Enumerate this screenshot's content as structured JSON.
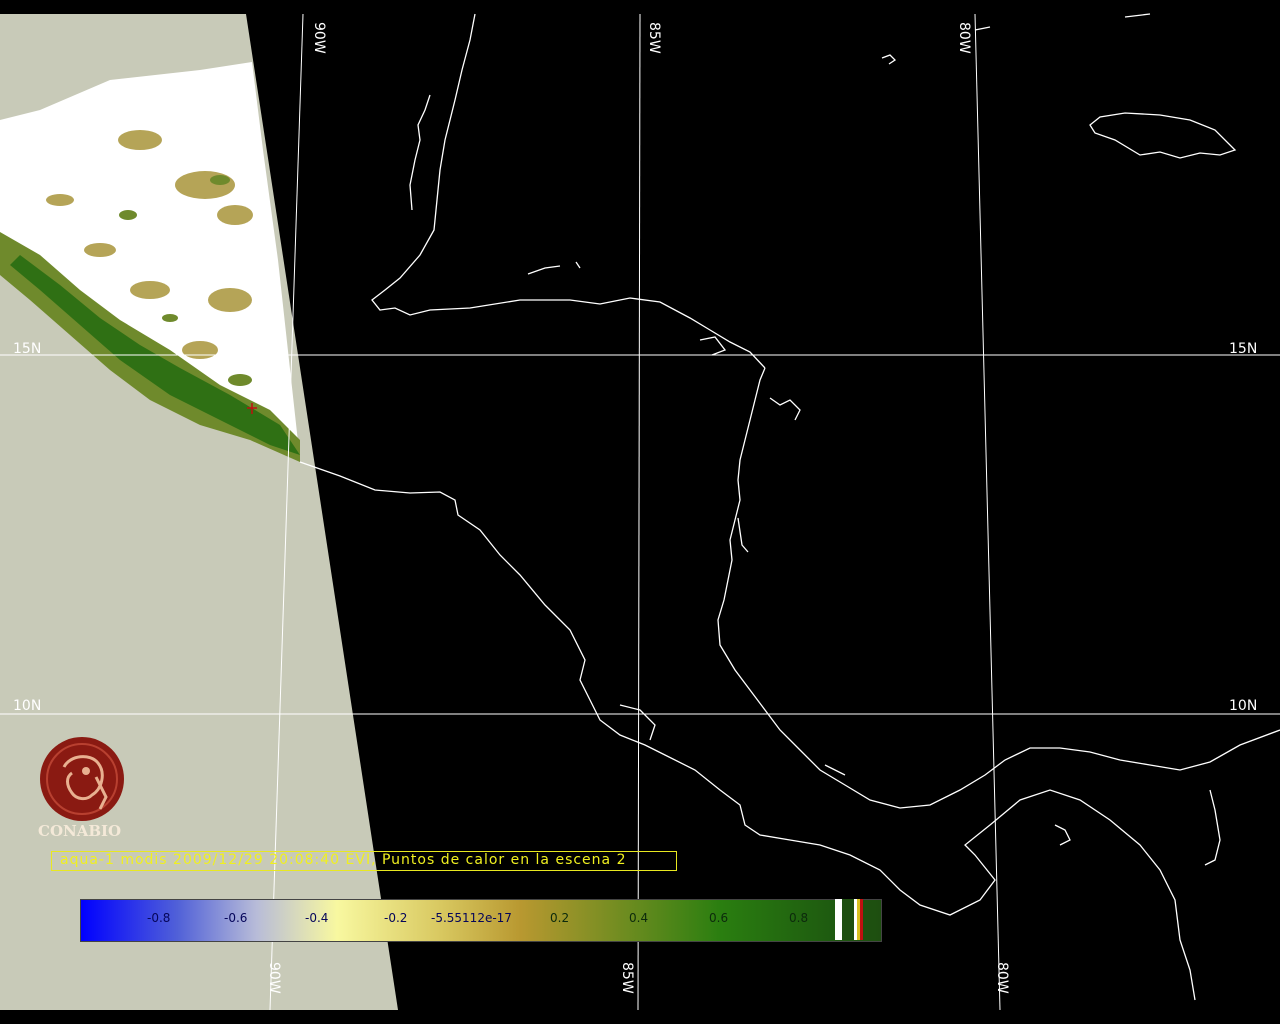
{
  "map": {
    "gridlines": {
      "meridians": [
        "90W",
        "85W",
        "80W"
      ],
      "parallels": [
        "15N",
        "10N"
      ]
    },
    "colors": {
      "background": "#000000",
      "out_of_swath": "#c8cab8",
      "cloud": "#ffffff",
      "coastline": "#ffffff",
      "gridline": "#ffffff",
      "caption": "#f0f020"
    }
  },
  "caption": {
    "text": "aqua-1 modis 2009/12/29 20:08:40 EVI, Puntos de calor en la escena 2"
  },
  "logo": {
    "name": "CONABIO",
    "icon": "conabio-macaw-logo"
  },
  "legend": {
    "ticks": [
      "-0.8",
      "-0.6",
      "-0.4",
      "-0.2",
      "-5.55112e-17",
      "0.2",
      "0.4",
      "0.6",
      "0.8"
    ],
    "colors": [
      "#0000ff",
      "#b8bcd8",
      "#f8f8a0",
      "#b89830",
      "#2a7e10",
      "#1e4e10"
    ]
  }
}
